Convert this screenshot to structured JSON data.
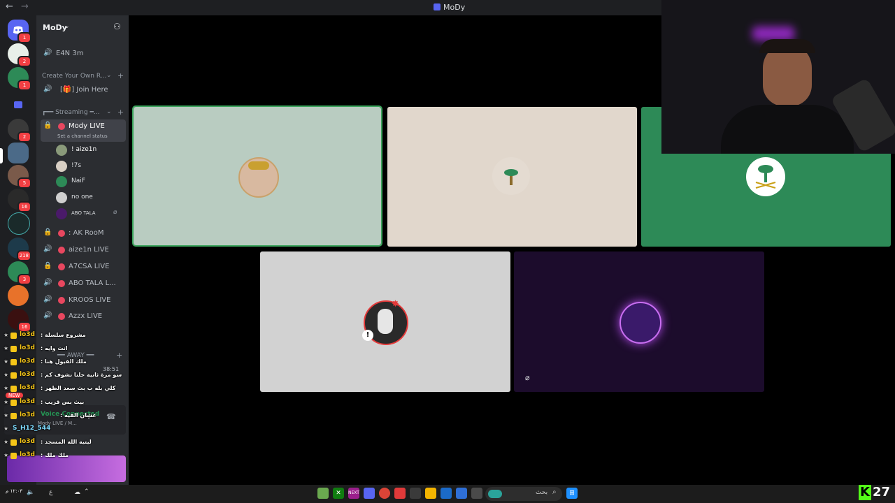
{
  "window": {
    "title": "MoDy"
  },
  "server_rail": {
    "badges": [
      "1",
      "2",
      "1",
      "2",
      "5",
      "16",
      "218",
      "3",
      "16"
    ]
  },
  "channels": {
    "server_name": "MoDy",
    "items": [
      {
        "type": "voice",
        "label": "E4N 3m"
      },
      {
        "type": "category",
        "label": "Create Your Own R..."
      },
      {
        "type": "voice",
        "label": "[🎁]  Join Here"
      },
      {
        "type": "category",
        "label": "┏━━ Streaming ━..."
      },
      {
        "type": "locked",
        "label": "Mody LIVE",
        "status": "Set a channel status"
      },
      {
        "type": "locked",
        "label": ": AK RooM"
      },
      {
        "type": "voice",
        "label": "aize1n LIVE"
      },
      {
        "type": "locked",
        "label": "A7CSA LIVE"
      },
      {
        "type": "voice",
        "label": "ABO TALA L..."
      },
      {
        "type": "voice",
        "label": "KROOS LIVE"
      },
      {
        "type": "voice",
        "label": "Azzx LIVE"
      }
    ],
    "voice_users": [
      "! aize1n",
      "!7s",
      "NaiF",
      "no one",
      "ABO TALA"
    ],
    "away_category": "━━ AWAY ━━",
    "call_timer": "38:51"
  },
  "chat": {
    "lines": [
      {
        "name": "lo3d",
        "text": ": مشروع سلسلة"
      },
      {
        "name": "lo3d",
        "text": ": انت وايه"
      },
      {
        "name": "lo3d",
        "text": ": ملك الفيول هنا"
      },
      {
        "name": "lo3d",
        "text": ": سو مرة ثانية خلنا نشوف كم"
      },
      {
        "name": "lo3d",
        "text": ": كلي بله ب بث سعد الظهر"
      },
      {
        "name": "lo3d",
        "text": ": بيث بس قريب"
      },
      {
        "name": "lo3d",
        "text": ": عشان الفيه"
      },
      {
        "name": "S_H12_544",
        "text": ""
      },
      {
        "name": "lo3d",
        "text": ": ليتيه الله المسجد"
      },
      {
        "name": "lo3d",
        "text": ": ملك ملك"
      }
    ],
    "voice_connected": "Voice Connected",
    "voice_channel": "Mody LIVE / M...",
    "new_badge": "NEW"
  },
  "taskbar": {
    "search_placeholder": "بحث",
    "clock": "١٢:٠٣ م"
  },
  "overlay": {
    "viewers": "27",
    "brand_letter": "K"
  },
  "colors": {
    "tile_selected": "#b9ccc1",
    "tile_beige": "#e1d7cc",
    "tile_green": "#2d8a57",
    "tile_grey": "#d2d2d2",
    "tile_purple": "#1c0c2c",
    "speaking_outline": "#3ba55c",
    "live_dot": "#e8475f"
  }
}
